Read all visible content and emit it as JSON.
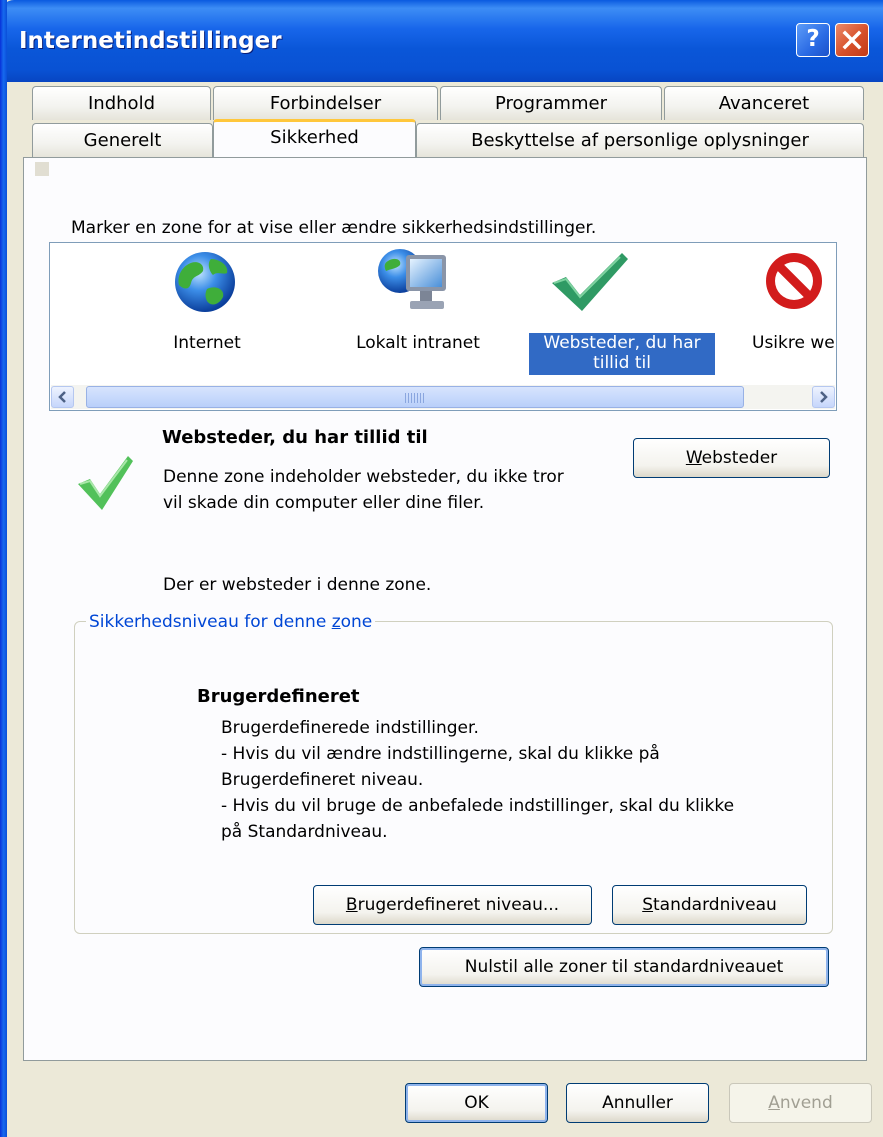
{
  "window": {
    "title": "Internetindstillinger",
    "help_label": "?"
  },
  "tabs": {
    "row_top": [
      "Indhold",
      "Forbindelser",
      "Programmer",
      "Avanceret"
    ],
    "row_bottom": [
      "Generelt",
      "Sikkerhed",
      "Beskyttelse af personlige oplysninger"
    ],
    "active": "Sikkerhed"
  },
  "security": {
    "instruction": "Marker en zone for at vise eller ændre sikkerhedsindstillinger.",
    "zones": [
      {
        "label": "Internet",
        "icon": "globe-icon"
      },
      {
        "label": "Lokalt intranet",
        "icon": "intranet-icon"
      },
      {
        "label": "Websteder, du har tillid til",
        "icon": "checkmark-icon",
        "selected": true
      },
      {
        "label": "Usikre webste",
        "icon": "restricted-icon"
      }
    ],
    "zone_info": {
      "title": "Websteder, du har tillid til",
      "description_line1": "Denne zone indeholder websteder, du ikke tror",
      "description_line2": "vil skade din computer eller dine filer.",
      "has_sites": "Der er websteder i denne zone.",
      "sites_button": "Websteder"
    },
    "level": {
      "group_title": "Sikkerhedsniveau for denne zone",
      "heading": "Brugerdefineret",
      "line1": "Brugerdefinerede indstillinger.",
      "line2": " - Hvis du vil ændre indstillingerne, skal du klikke på",
      "line3": "Brugerdefineret niveau.",
      "line4": "- Hvis du vil bruge de anbefalede indstillinger, skal du klikke",
      "line5": "på Standardniveau.",
      "custom_button": "Brugerdefineret niveau...",
      "default_button": "Standardniveau"
    },
    "reset_button": "Nulstil alle zoner til standardniveauet"
  },
  "footer": {
    "ok": "OK",
    "cancel": "Annuller",
    "apply": "Anvend"
  },
  "colors": {
    "titlebar": "#0a56d8",
    "selection": "#316ac5",
    "group_title": "#0046d5",
    "tab_highlight": "#ffc73c"
  }
}
